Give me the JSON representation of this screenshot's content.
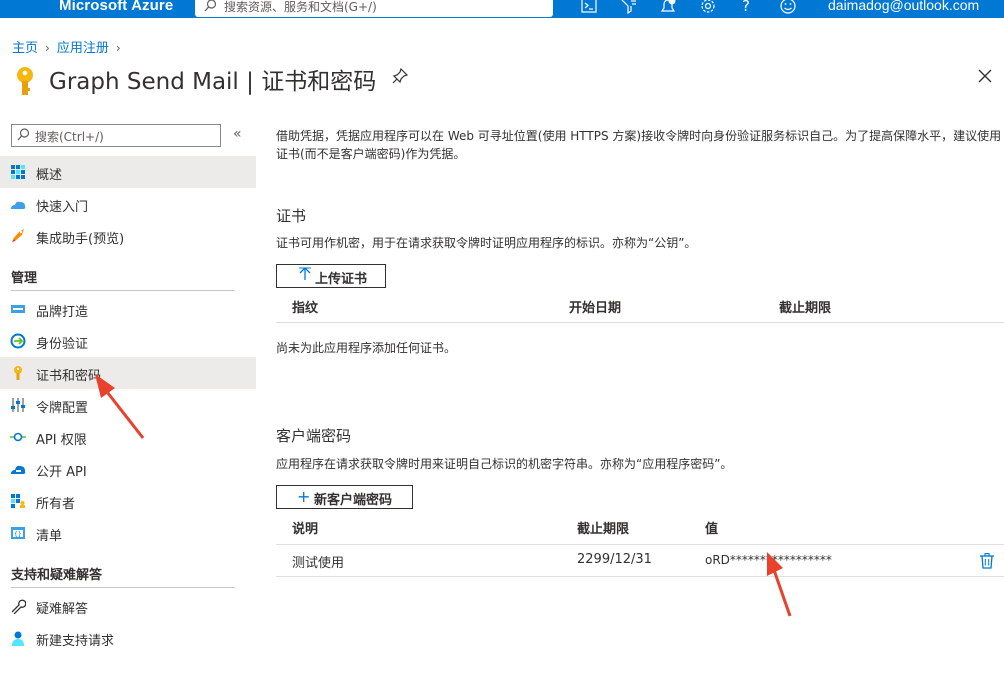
{
  "topbar": {
    "brand": "Microsoft Azure",
    "search_placeholder": "搜索资源、服务和文档(G+/)",
    "user": "daimadog@outlook.com",
    "notification_count": "1",
    "icons": [
      "cloud-shell-icon",
      "directory-filter-icon",
      "notifications-icon",
      "settings-icon",
      "help-icon",
      "feedback-icon"
    ]
  },
  "breadcrumb": [
    {
      "label": "主页"
    },
    {
      "label": "应用注册"
    }
  ],
  "header": {
    "title": "Graph Send Mail | 证书和密码"
  },
  "sidebar": {
    "search_placeholder": "搜索(Ctrl+/)",
    "collapse_glyph": "«",
    "items": [
      {
        "label": "概述",
        "icon": "overview-icon"
      },
      {
        "label": "快速入门",
        "icon": "quickstart-icon"
      },
      {
        "label": "集成助手(预览)",
        "icon": "integration-assistant-icon"
      }
    ],
    "manage_title": "管理",
    "manage_items": [
      {
        "label": "品牌打造",
        "icon": "branding-icon"
      },
      {
        "label": "身份验证",
        "icon": "authentication-icon"
      },
      {
        "label": "证书和密码",
        "icon": "key-icon",
        "active": true
      },
      {
        "label": "令牌配置",
        "icon": "token-config-icon"
      },
      {
        "label": "API 权限",
        "icon": "api-permissions-icon"
      },
      {
        "label": "公开 API",
        "icon": "expose-api-icon"
      },
      {
        "label": "所有者",
        "icon": "owners-icon"
      },
      {
        "label": "清单",
        "icon": "manifest-icon"
      }
    ],
    "support_title": "支持和疑难解答",
    "support_items": [
      {
        "label": "疑难解答",
        "icon": "wrench-icon"
      },
      {
        "label": "新建支持请求",
        "icon": "support-request-icon"
      }
    ]
  },
  "main": {
    "intro": "借助凭据，凭据应用程序可以在 Web 可寻址位置(使用 HTTPS 方案)接收令牌时向身份验证服务标识自己。为了提高保障水平，建议使用证书(而不是客户端密码)作为凭据。",
    "certificates": {
      "title": "证书",
      "description": "证书可用作机密，用于在请求获取令牌时证明应用程序的标识。亦称为“公钥”。",
      "upload_button": "上传证书",
      "columns": [
        "指纹",
        "开始日期",
        "截止期限"
      ],
      "empty_text": "尚未为此应用程序添加任何证书。"
    },
    "client_secrets": {
      "title": "客户端密码",
      "description": "应用程序在请求获取令牌时用来证明自己标识的机密字符串。亦称为“应用程序密码”。",
      "new_button": "新客户端密码",
      "columns": [
        "说明",
        "截止期限",
        "值"
      ],
      "rows": [
        {
          "description": "测试使用",
          "expires": "2299/12/31",
          "value": "oRD*****************"
        }
      ]
    }
  },
  "colors": {
    "azure_blue": "#0078d4",
    "active_bg": "#edebe9",
    "annotation_red": "#e8412c"
  }
}
